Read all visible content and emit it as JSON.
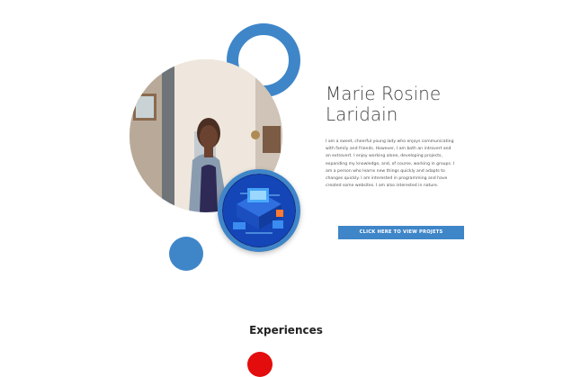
{
  "profile": {
    "name": "Marie Rosine Laridain",
    "bio": "I am a sweet, cheerful young lady who enjoys communicating with family and friends. However, I am both an introvert and an extrovert. I enjoy working alone, developing projects, expanding my knowledge, and, of course, working in groups. I am a person who learns new things quickly and adapts to changes quickly. I am interested in programming and have created some websites. I am also interested in nature.",
    "cta_label": "CLICK HERE TO VIEW PROJETS"
  },
  "sections": {
    "experiences_title": "Experiences"
  },
  "colors": {
    "accent": "#3f86c9",
    "marker_red": "#e30d0d"
  }
}
